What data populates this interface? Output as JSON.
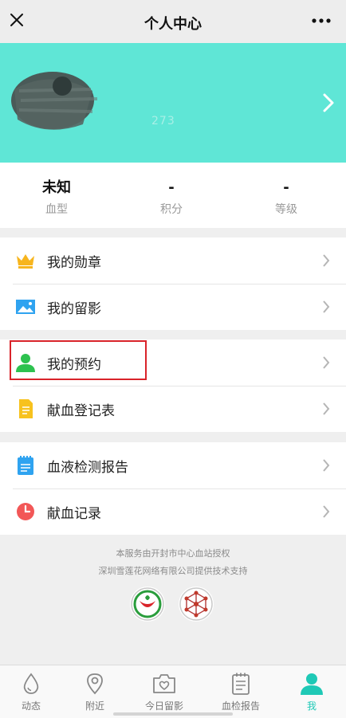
{
  "topbar": {
    "title": "个人中心"
  },
  "profile": {
    "nickname_fragment": "273"
  },
  "stats": [
    {
      "value": "未知",
      "label": "血型"
    },
    {
      "value": "-",
      "label": "积分"
    },
    {
      "value": "-",
      "label": "等级"
    }
  ],
  "menu": {
    "group1": [
      {
        "label": "我的勋章",
        "icon": "crown-icon"
      },
      {
        "label": "我的留影",
        "icon": "image-icon"
      }
    ],
    "group2": [
      {
        "label": "我的预约",
        "icon": "person-icon"
      },
      {
        "label": "献血登记表",
        "icon": "document-icon"
      }
    ],
    "group3": [
      {
        "label": "血液检测报告",
        "icon": "notepad-icon"
      },
      {
        "label": "献血记录",
        "icon": "clock-icon"
      }
    ]
  },
  "footer": {
    "line1": "本服务由开封市中心血站授权",
    "line2": "深圳雪莲花网络有限公司提供技术支持"
  },
  "tabs": [
    {
      "label": "动态",
      "icon": "drop-icon"
    },
    {
      "label": "附近",
      "icon": "location-pin-icon"
    },
    {
      "label": "今日留影",
      "icon": "camera-heart-icon"
    },
    {
      "label": "血检报告",
      "icon": "report-icon"
    },
    {
      "label": "我",
      "icon": "user-icon"
    }
  ],
  "colors": {
    "banner": "#5fe6d6",
    "accent": "#1fc9b6",
    "highlight_border": "#d9232a"
  }
}
